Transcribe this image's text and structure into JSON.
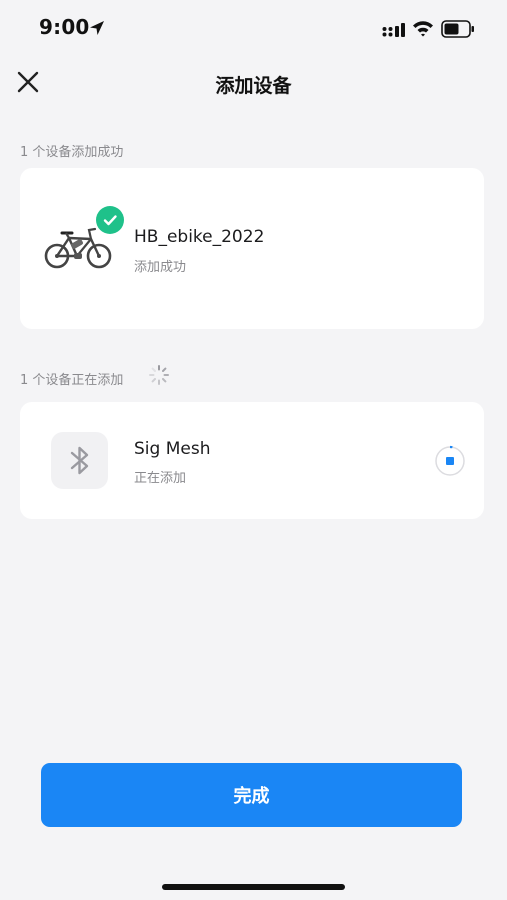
{
  "status_bar": {
    "time": "9:00"
  },
  "nav": {
    "title": "添加设备"
  },
  "success_section": {
    "label": "1 个设备添加成功",
    "device": {
      "name": "HB_ebike_2022",
      "status": "添加成功",
      "icon": "bicycle-icon"
    }
  },
  "adding_section": {
    "label": "1 个设备正在添加",
    "device": {
      "name": "Sig Mesh",
      "status": "正在添加",
      "icon": "bluetooth-icon"
    }
  },
  "done_button": {
    "label": "完成"
  },
  "colors": {
    "accent": "#1a86f5",
    "success": "#1fc18a",
    "background": "#f4f4f6"
  }
}
